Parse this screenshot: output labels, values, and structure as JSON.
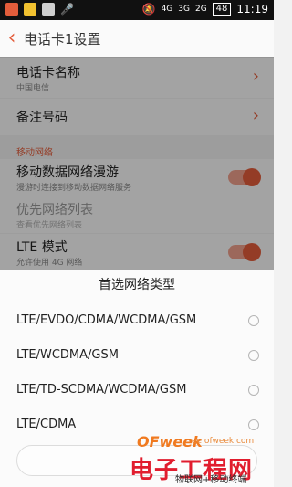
{
  "status_bar": {
    "network_4g": "4G",
    "network_3g": "3G",
    "network_2g": "2G",
    "battery": "48",
    "time": "11:19"
  },
  "header": {
    "title": "电话卡1设置"
  },
  "settings": {
    "sim_name": {
      "title": "电话卡名称",
      "subtitle": "中国电信"
    },
    "backup_number": {
      "title": "备注号码"
    },
    "mobile_network_section": "移动网络",
    "roaming": {
      "title": "移动数据网络漫游",
      "subtitle": "漫游时连接到移动数据网络服务"
    },
    "preferred_list": {
      "title": "优先网络列表",
      "subtitle": "查看优先网络列表"
    },
    "lte_mode": {
      "title": "LTE 模式",
      "subtitle": "允许使用 4G 网络"
    }
  },
  "dialog": {
    "title": "首选网络类型",
    "options": [
      "LTE/EVDO/CDMA/WCDMA/GSM",
      "LTE/WCDMA/GSM",
      "LTE/TD-SCDMA/WCDMA/GSM",
      "LTE/CDMA"
    ]
  },
  "watermark": {
    "brand": "OFweek",
    "domain": "ee.ofweek.com",
    "site_name": "电子工程网",
    "caption": "物联网+移动终端"
  },
  "colors": {
    "accent": "#e45d3b",
    "toggle_track": "#f0a08d"
  }
}
